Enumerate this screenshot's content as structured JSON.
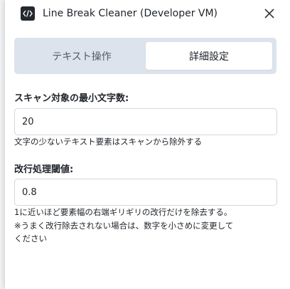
{
  "header": {
    "app_icon": "code-icon",
    "title": "Line Break Cleaner (Developer VM)",
    "close_icon": "close-icon"
  },
  "tabs": [
    {
      "label": "テキスト操作",
      "active": false
    },
    {
      "label": "詳細設定",
      "active": true
    }
  ],
  "settings": {
    "min_chars": {
      "label": "スキャン対象の最小文字数:",
      "value": "20",
      "help": "文字の少ないテキスト要素はスキャンから除外する"
    },
    "threshold": {
      "label": "改行処理閾値:",
      "value": "0.8",
      "help_line1": "1に近いほど要素幅の右端ギリギリの改行だけを除去する。",
      "help_line2": "※うまく改行除去されない場合は、数字を小さめに変更して",
      "help_line3": "ください"
    }
  },
  "colors": {
    "tab_track": "#dde3ec",
    "icon_bg": "#24292f",
    "border": "#d4d7dc"
  }
}
